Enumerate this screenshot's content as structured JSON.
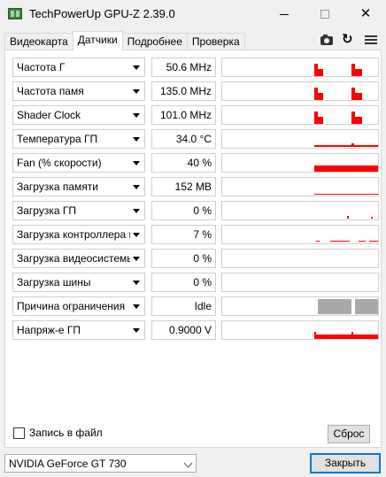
{
  "window": {
    "title": "TechPowerUp GPU-Z 2.39.0"
  },
  "tabs": [
    {
      "label": "Видеокарта"
    },
    {
      "label": "Датчики"
    },
    {
      "label": "Подробнее"
    },
    {
      "label": "Проверка"
    }
  ],
  "sensors": [
    {
      "label": "Частота Г",
      "value": "50.6 MHz",
      "graph": "spikes"
    },
    {
      "label": "Частота памя",
      "value": "135.0 MHz",
      "graph": "spikes"
    },
    {
      "label": "Shader Clock",
      "value": "101.0 MHz",
      "graph": "spikes"
    },
    {
      "label": "Температура ГП",
      "value": "34.0 °C",
      "graph": "thin"
    },
    {
      "label": "Fan (% скорости)",
      "value": "40 %",
      "graph": "band"
    },
    {
      "label": "Загрузка памяти",
      "value": "152 MB",
      "graph": "line"
    },
    {
      "label": "Загрузка ГП",
      "value": "0 %",
      "graph": "dots"
    },
    {
      "label": "Загрузка контроллера пам.",
      "value": "7 %",
      "graph": "dashes"
    },
    {
      "label": "Загрузка видеосистемы",
      "value": "0 %",
      "graph": "none"
    },
    {
      "label": "Загрузка шины",
      "value": "0 %",
      "graph": "none"
    },
    {
      "label": "Причина ограничения",
      "value": "Idle",
      "graph": "gray"
    },
    {
      "label": "Напряж-е ГП",
      "value": "0.9000 V",
      "graph": "voltage"
    }
  ],
  "footer": {
    "log_label": "Запись в файл",
    "reset_label": "Сброс",
    "gpu_selected": "NVIDIA GeForce GT 730",
    "close_label": "Закрыть"
  },
  "colors": {
    "graph": "#ff0000",
    "idle": "#a9a9a9",
    "accent": "#0078d7"
  },
  "icons": [
    "camera-icon",
    "refresh-icon",
    "menu-icon"
  ]
}
